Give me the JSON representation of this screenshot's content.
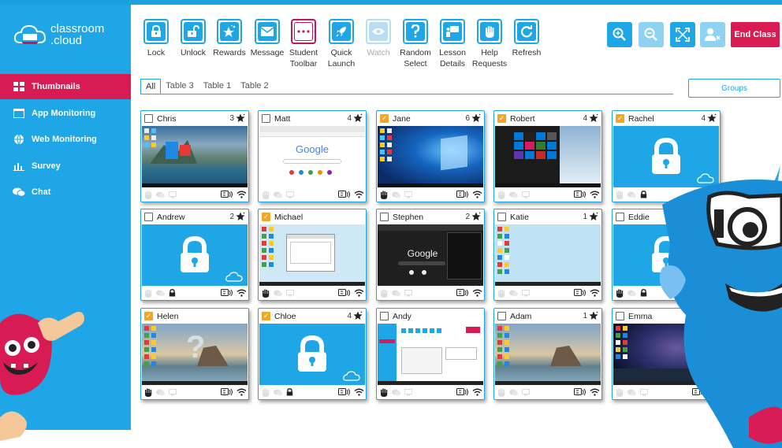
{
  "app": {
    "logo_line1": "classroom",
    "logo_line2": ".cloud"
  },
  "sidebar": {
    "items": [
      {
        "label": "Thumbnails",
        "icon": "grid-icon",
        "active": true
      },
      {
        "label": "App Monitoring",
        "icon": "window-icon",
        "active": false
      },
      {
        "label": "Web Monitoring",
        "icon": "globe-icon",
        "active": false
      },
      {
        "label": "Survey",
        "icon": "bar-chart-icon",
        "active": false
      },
      {
        "label": "Chat",
        "icon": "chat-bubbles-icon",
        "active": false
      }
    ]
  },
  "toolbar": {
    "items": [
      {
        "line1": "Lock",
        "line2": "",
        "icon": "lock-icon",
        "state": "enabled"
      },
      {
        "line1": "Unlock",
        "line2": "",
        "icon": "unlock-icon",
        "state": "enabled"
      },
      {
        "line1": "Rewards",
        "line2": "",
        "icon": "star-sparkle-icon",
        "state": "enabled"
      },
      {
        "line1": "Message",
        "line2": "",
        "icon": "envelope-icon",
        "state": "enabled"
      },
      {
        "line1": "Student",
        "line2": "Toolbar",
        "icon": "dots-icon",
        "state": "active"
      },
      {
        "line1": "Quick",
        "line2": "Launch",
        "icon": "rocket-icon",
        "state": "enabled"
      },
      {
        "line1": "Watch",
        "line2": "",
        "icon": "eye-icon",
        "state": "disabled"
      },
      {
        "line1": "Random",
        "line2": "Select",
        "icon": "question-icon",
        "state": "enabled"
      },
      {
        "line1": "Lesson",
        "line2": "Details",
        "icon": "presentation-icon",
        "state": "enabled"
      },
      {
        "line1": "Help",
        "line2": "Requests",
        "icon": "raised-hand-icon",
        "state": "enabled"
      },
      {
        "line1": "Refresh",
        "line2": "",
        "icon": "refresh-icon",
        "state": "enabled"
      }
    ],
    "right_buttons": [
      {
        "icon": "zoom-in-icon",
        "state": "enabled"
      },
      {
        "icon": "zoom-out-icon",
        "state": "disabled"
      },
      {
        "icon": "fullscreen-icon",
        "state": "enabled"
      },
      {
        "icon": "remove-user-icon",
        "state": "disabled"
      }
    ],
    "end_class_label": "End Class"
  },
  "tabs": {
    "items": [
      "All",
      "Table 3",
      "Table 1",
      "Table 2"
    ],
    "active": "All",
    "groups_label": "Groups"
  },
  "students": [
    {
      "name": "Chris",
      "checked": false,
      "rewards": "3",
      "screen": "landscape-desktop",
      "hand_raised": false,
      "lock": false
    },
    {
      "name": "Matt",
      "checked": false,
      "rewards": "4",
      "screen": "google-browser",
      "hand_raised": false,
      "lock": false
    },
    {
      "name": "Jane",
      "checked": true,
      "rewards": "6",
      "screen": "windows-desktop",
      "hand_raised": true,
      "lock": false
    },
    {
      "name": "Robert",
      "checked": true,
      "rewards": "4",
      "screen": "start-menu",
      "hand_raised": false,
      "lock": false
    },
    {
      "name": "Rachel",
      "checked": true,
      "rewards": "4",
      "screen": "locked",
      "hand_raised": false,
      "lock": true
    },
    {
      "name": "Andrew",
      "checked": false,
      "rewards": "2",
      "screen": "locked",
      "hand_raised": false,
      "lock": true
    },
    {
      "name": "Michael",
      "checked": true,
      "rewards": "",
      "screen": "dialog-desktop",
      "hand_raised": true,
      "lock": false
    },
    {
      "name": "Stephen",
      "checked": false,
      "rewards": "2",
      "screen": "dark-google",
      "hand_raised": false,
      "lock": false
    },
    {
      "name": "Katie",
      "checked": false,
      "rewards": "1",
      "screen": "icons-desktop",
      "hand_raised": false,
      "lock": false
    },
    {
      "name": "Eddie",
      "checked": false,
      "rewards": "",
      "screen": "locked",
      "hand_raised": true,
      "lock": true
    },
    {
      "name": "Helen",
      "checked": true,
      "rewards": "",
      "screen": "beach-question",
      "hand_raised": true,
      "lock": false
    },
    {
      "name": "Chloe",
      "checked": true,
      "rewards": "4",
      "screen": "locked",
      "hand_raised": false,
      "lock": true
    },
    {
      "name": "Andy",
      "checked": false,
      "rewards": "",
      "screen": "classroom-app",
      "hand_raised": true,
      "lock": false
    },
    {
      "name": "Adam",
      "checked": false,
      "rewards": "1",
      "screen": "beach-desktop",
      "hand_raised": false,
      "lock": false
    },
    {
      "name": "Emma",
      "checked": false,
      "rewards": "",
      "screen": "night-sky",
      "hand_raised": false,
      "lock": false
    }
  ],
  "screen_texts": {
    "google": "Google"
  },
  "colors": {
    "brand_blue": "#1ea6e6",
    "active_pink": "#d81b53",
    "checkbox_orange": "#f0a626"
  }
}
